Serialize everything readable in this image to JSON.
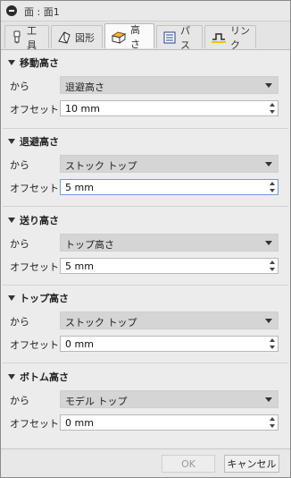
{
  "title": "面 : 面1",
  "tabs": [
    {
      "label": "工具",
      "icon": "tool-icon"
    },
    {
      "label": "図形",
      "icon": "geometry-icon"
    },
    {
      "label": "高さ",
      "icon": "height-icon"
    },
    {
      "label": "パス",
      "icon": "path-icon"
    },
    {
      "label": "リンク",
      "icon": "link-icon"
    }
  ],
  "active_tab": "高さ",
  "sections": [
    {
      "heading": "移動高さ",
      "from_label": "から",
      "from_value": "退避高さ",
      "offset_label": "オフセット",
      "offset_value": "10 mm"
    },
    {
      "heading": "退避高さ",
      "from_label": "から",
      "from_value": "ストック トップ",
      "offset_label": "オフセット",
      "offset_value": "5 mm"
    },
    {
      "heading": "送り高さ",
      "from_label": "から",
      "from_value": "トップ高さ",
      "offset_label": "オフセット",
      "offset_value": "5 mm"
    },
    {
      "heading": "トップ高さ",
      "from_label": "から",
      "from_value": "ストック トップ",
      "offset_label": "オフセット",
      "offset_value": "0 mm"
    },
    {
      "heading": "ボトム高さ",
      "from_label": "から",
      "from_value": "モデル トップ",
      "offset_label": "オフセット",
      "offset_value": "0 mm"
    }
  ],
  "footer": {
    "ok_label": "OK",
    "cancel_label": "キャンセル"
  }
}
